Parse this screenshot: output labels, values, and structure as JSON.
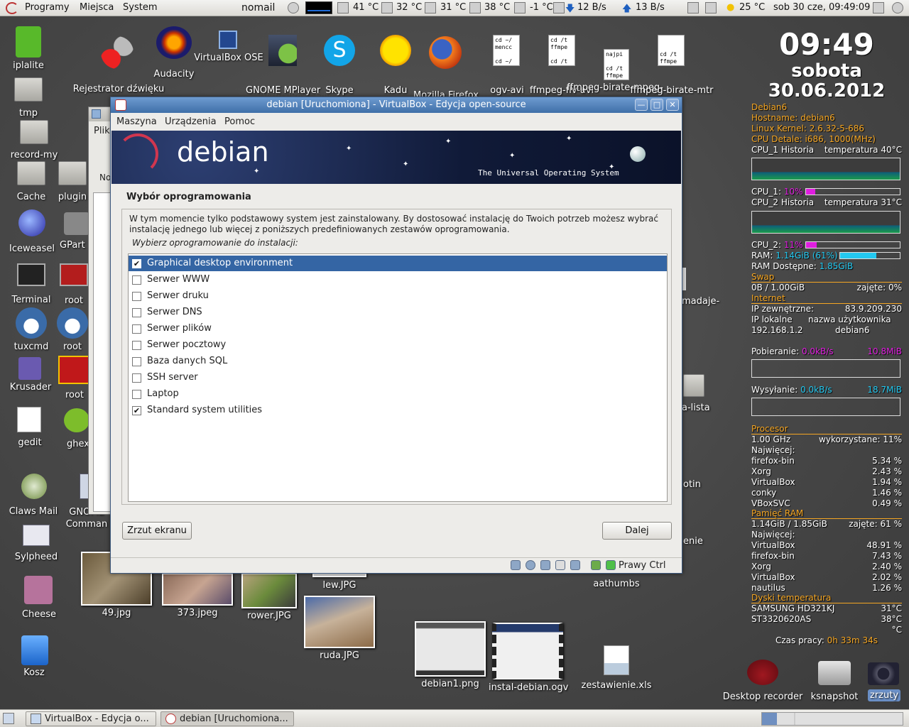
{
  "top_panel": {
    "menus": [
      "Programy",
      "Miejsca",
      "System"
    ],
    "mail_label": "nomail",
    "temps": [
      "41 °C",
      "32 °C",
      "31 °C",
      "38 °C",
      "-1 °C"
    ],
    "net_down": "12 B/s",
    "net_up": "13 B/s",
    "weather": "25 °C",
    "clock": "sob 30 cze, 09:49:09"
  },
  "desktop_icons": {
    "iplalite": "iplalite",
    "rejestrator": "Rejestrator dźwięku",
    "audacity": "Audacity",
    "virtualbox": "VirtualBox OSE",
    "mplayer": "GNOME MPlayer",
    "skype": "Skype",
    "kadu": "Kadu",
    "firefox": "Mozilla Firefox",
    "ogv_avi": "ogv-avi",
    "ffmpeg_flv": "ffmpeg-flv-avi",
    "ffmpeg_birate": "ffmpeg-birate-mpeg-",
    "ffmpeg_birate_mtr": "ffmpeg-birate-mtr",
    "tmp": "tmp",
    "record": "record-my",
    "cache": "Cache",
    "plugin": "plugin",
    "iceweasel": "Iceweasel",
    "gparted": "GPart",
    "terminal": "Terminal",
    "root1": "root",
    "tuxcmd": "tuxcmd",
    "root2": "root",
    "krusader": "Krusader",
    "root3": "root",
    "gedit": "gedit",
    "ghex": "ghex",
    "claws": "Claws Mail",
    "gnome_commander": "GNOME\nComman",
    "sylpheed": "Sylpheed",
    "cheese": "Cheese",
    "kosz": "Kosz",
    "photo_49": "49.jpg",
    "photo_373": "373.jpeg",
    "photo_rower": "rower.JPG",
    "photo_lew": "lew.JPG",
    "photo_ruda": "ruda.JPG",
    "debian1": "debian1.png",
    "instal": "instal-debian.ogv",
    "zestawienie": "zestawienie.xls",
    "aathumbs": "aathumbs",
    "madaje": "madaje-",
    "a_lista": "a-lista",
    "otin": "otin",
    "enie": "enie",
    "desktop_recorder": "Desktop recorder",
    "ksnapshot": "ksnapshot",
    "zrzuty": "zrzuty"
  },
  "small_docs": {
    "ogv_avi_lines": [
      "cd ~/",
      "mencc",
      "",
      "cd ~/"
    ],
    "ffmpeg_flv_lines": [
      "cd /t",
      "ffmpe",
      "",
      "cd /t"
    ],
    "najpi_lines": [
      "najpi",
      "",
      "cd /t",
      "ffmpe"
    ],
    "mtr_lines": [
      "cd /t",
      "ffmpe"
    ]
  },
  "bg_window": {
    "menu_text": "Plik",
    "title_text": "VirtualBox - Edycja",
    "no_text": "No"
  },
  "vbox": {
    "title": "debian [Uruchomiona] - VirtualBox - Edycja open-source",
    "menu": [
      "Maszyna",
      "Urządzenia",
      "Pomoc"
    ],
    "banner_logo": "debian",
    "banner_tagline": "The Universal Operating System",
    "section_title": "Wybór oprogramowania",
    "description": "W tym momencie tylko podstawowy system jest zainstalowany. By dostosować instalację do Twoich potrzeb możesz wybrać instalację jednego lub więcej z poniższych predefiniowanych zestawów oprogramowania.",
    "prompt": "Wybierz oprogramowanie do instalacji:",
    "packages": [
      {
        "label": "Graphical desktop environment",
        "checked": true
      },
      {
        "label": "Serwer WWW",
        "checked": false
      },
      {
        "label": "Serwer druku",
        "checked": false
      },
      {
        "label": "Serwer DNS",
        "checked": false
      },
      {
        "label": "Serwer plików",
        "checked": false
      },
      {
        "label": "Serwer pocztowy",
        "checked": false
      },
      {
        "label": "Baza danych SQL",
        "checked": false
      },
      {
        "label": "SSH server",
        "checked": false
      },
      {
        "label": "Laptop",
        "checked": false
      },
      {
        "label": "Standard system utilities",
        "checked": true
      }
    ],
    "screenshot_button": "Zrzut ekranu",
    "next_button": "Dalej",
    "host_key": "Prawy Ctrl"
  },
  "conky": {
    "clock": "09:49",
    "day": "sobota",
    "date": "30.06.2012",
    "distro": "Debian6",
    "hostname": "Hostname: debian6",
    "kernel": "Linux Kernel: 2.6.32-5-686",
    "cpu_detail": "CPU Detale:  i686, 1000(MHz)",
    "cpu1_hist": "CPU_1 Historia",
    "cpu1_temp": "temperatura 40°C",
    "cpu1_label": "CPU_1:",
    "cpu1_val": "10%",
    "cpu1_fill": 0.1,
    "cpu2_hist": "CPU_2 Historia",
    "cpu2_temp": "temperatura 31°C",
    "cpu2_label": "CPU_2:",
    "cpu2_val": "11%",
    "cpu2_fill": 0.11,
    "ram_label": "RAM:",
    "ram_val": "1.14GiB (61%)",
    "ram_fill": 0.61,
    "ram_avail_label": "RAM Dostępne:",
    "ram_avail_val": "1.85GiB",
    "swap_title": "Swap",
    "swap_left": "0B   / 1.00GiB",
    "swap_right": "zajęte: 0%",
    "internet_title": "Internet",
    "ip_ext_label": "IP zewnętrzne:",
    "ip_ext_val": "83.9.209.230",
    "ip_local_label": "IP lokalne",
    "user_label": "nazwa użytkownika",
    "ip_local_val": "192.168.1.2",
    "user_val": "debian6",
    "down_label": "Pobieranie:",
    "down_val": "0.0kB/s",
    "down_max": "10.8MiB",
    "up_label": "Wysyłanie:",
    "up_val": "0.0kB/s",
    "up_max": "18.7MiB",
    "proc_title": "Procesor",
    "proc_freq": "1.00 GHz",
    "proc_used": "wykorzystane: 11%",
    "most_label": "Najwięcej:",
    "proc_list": [
      {
        "name": "firefox-bin",
        "val": "5.34 %"
      },
      {
        "name": "Xorg",
        "val": "2.43 %"
      },
      {
        "name": "VirtualBox",
        "val": "1.94 %"
      },
      {
        "name": "conky",
        "val": "1.46 %"
      },
      {
        "name": "VBoxSVC",
        "val": "0.49 %"
      }
    ],
    "mem_title": "Pamięć RAM",
    "mem_left": "1.14GiB / 1.85GiB",
    "mem_right": "zajęte: 61 %",
    "mem_most": "Najwięcej:",
    "mem_list": [
      {
        "name": "VirtualBox",
        "val": "48.91 %"
      },
      {
        "name": "firefox-bin",
        "val": "7.43 %"
      },
      {
        "name": "Xorg",
        "val": "2.40 %"
      },
      {
        "name": "VirtualBox",
        "val": "2.02 %"
      },
      {
        "name": "nautilus",
        "val": "1.26 %"
      }
    ],
    "disk_title": "Dyski temperatura",
    "disk1": "SAMSUNG HD321KJ",
    "disk1_temp": "31°C",
    "disk2": "ST3320620AS",
    "disk2_temp": "38°C",
    "disk2_unit": "°C",
    "uptime_label": "Czas pracy:",
    "uptime_val": "0h 33m 34s"
  },
  "taskbar": {
    "task1": "VirtualBox - Edycja o...",
    "task2": "debian [Uruchomiona..."
  },
  "colors": {
    "title_blue": "#3f6fa8",
    "selection": "#3465a4",
    "conky_orange": "#f5a623",
    "conky_cyan": "#23c8f0",
    "conky_magenta": "#e01ee0"
  }
}
